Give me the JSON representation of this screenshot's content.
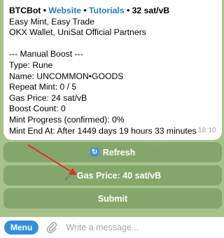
{
  "message": {
    "bot_name": "BTCBot",
    "separator": "•",
    "website_link": "Website",
    "tutorials_link": "Tutorials",
    "fee_rate": "32 sat/vB",
    "lines": [
      "Easy Mint, Easy Trade",
      "OKX Wallet, UniSat Official Partners",
      "",
      "--- Manual Boost ---",
      "Type: Rune",
      "Name: UNCOMMON•GOODS",
      "Repeat Mint: 0 / 5",
      "Gas Price: 24 sat/vB",
      "Boost Count: 0",
      "Mint Progress (confirmed): 0%",
      "Mint End At: After 1449 days 19 hours 33 minutes"
    ],
    "time": "18:10"
  },
  "keyboard": {
    "refresh_icon": "refresh-icon",
    "refresh_label": "Refresh",
    "gas_icon": "pencil-icon",
    "gas_label": "Gas Price: 40 sat/vB",
    "submit_label": "Submit"
  },
  "composer": {
    "menu_label": "Menu",
    "attach_icon": "paperclip-icon",
    "placeholder": "Write a message..."
  },
  "colors": {
    "accent": "#2f8fe0",
    "link": "#2a7ab8",
    "annotation_arrow": "#e0302a"
  }
}
